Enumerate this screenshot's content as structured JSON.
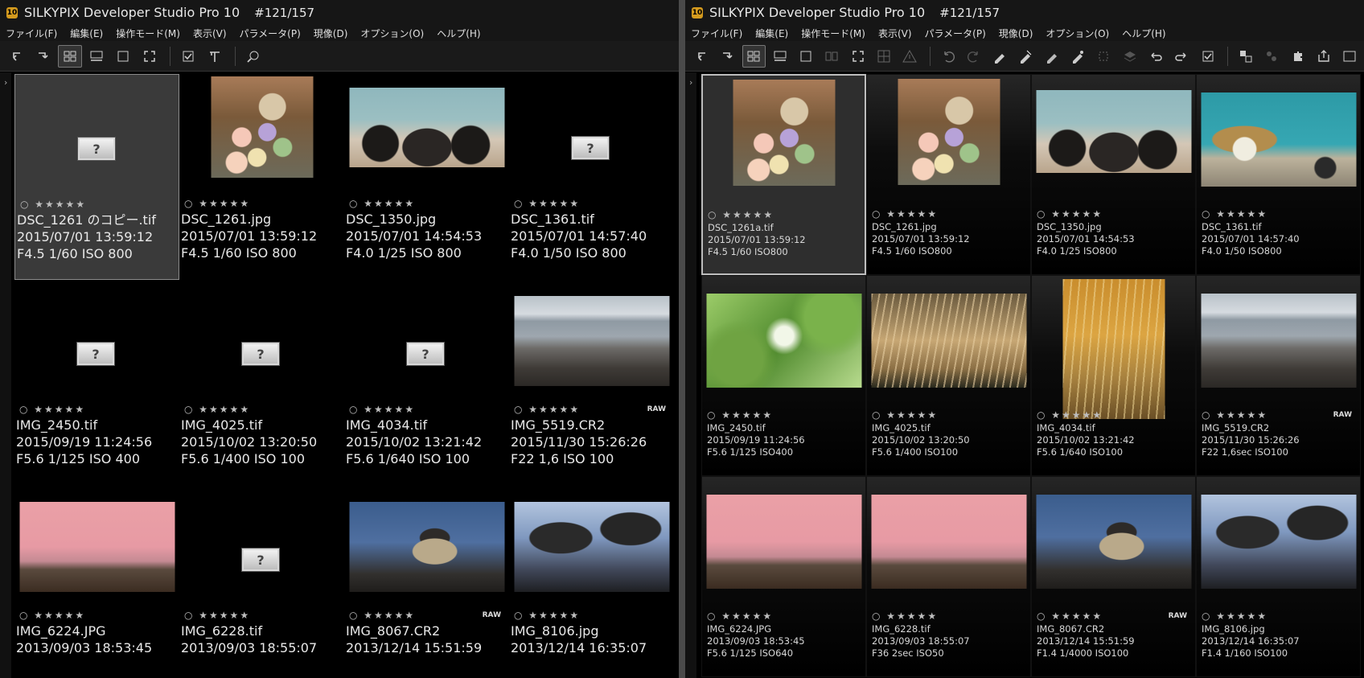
{
  "left": {
    "title": "SILKYPIX Developer Studio Pro 10",
    "counter": "#121/157",
    "logo": "10",
    "menu": [
      "ファイル(F)",
      "編集(E)",
      "操作モード(M)",
      "表示(V)",
      "パラメータ(P)",
      "現像(D)",
      "オプション(O)",
      "ヘルプ(H)"
    ],
    "collapse": "›",
    "items": [
      {
        "name": "DSC_1261 のコピー.tif",
        "date": "2015/07/01 13:59:12",
        "exif": "F4.5 1/60 ISO 800",
        "stars": "○ ★★★★★",
        "thumb": "none",
        "selected": true
      },
      {
        "name": "DSC_1261.jpg",
        "date": "2015/07/01 13:59:12",
        "exif": "F4.5 1/60 ISO 800",
        "stars": "○ ★★★★★",
        "thumb": "flowers"
      },
      {
        "name": "DSC_1350.jpg",
        "date": "2015/07/01 14:54:53",
        "exif": "F4.0 1/25 ISO 800",
        "stars": "○ ★★★★★",
        "thumb": "car"
      },
      {
        "name": "DSC_1361.tif",
        "date": "2015/07/01 14:57:40",
        "exif": "F4.0 1/50 ISO 800",
        "stars": "○ ★★★★★",
        "thumb": "none"
      },
      {
        "name": "IMG_2450.tif",
        "date": "2015/09/19 11:24:56",
        "exif": "F5.6 1/125 ISO 400",
        "stars": "○ ★★★★★",
        "thumb": "none"
      },
      {
        "name": "IMG_4025.tif",
        "date": "2015/10/02 13:20:50",
        "exif": "F5.6 1/400 ISO 100",
        "stars": "○ ★★★★★",
        "thumb": "none"
      },
      {
        "name": "IMG_4034.tif",
        "date": "2015/10/02 13:21:42",
        "exif": "F5.6 1/640 ISO 100",
        "stars": "○ ★★★★★",
        "thumb": "none"
      },
      {
        "name": "IMG_5519.CR2",
        "date": "2015/11/30 15:26:26",
        "exif": "F22 1,6 ISO 100",
        "stars": "○ ★★★★★",
        "thumb": "lake",
        "raw": "RAW"
      },
      {
        "name": "IMG_6224.JPG",
        "date": "2013/09/03 18:53:45",
        "exif": "",
        "stars": "○ ★★★★★",
        "thumb": "pink"
      },
      {
        "name": "IMG_6228.tif",
        "date": "2013/09/03 18:55:07",
        "exif": "",
        "stars": "○ ★★★★★",
        "thumb": "none"
      },
      {
        "name": "IMG_8067.CR2",
        "date": "2013/12/14 15:51:59",
        "exif": "",
        "stars": "○ ★★★★★",
        "thumb": "dome",
        "raw": "RAW"
      },
      {
        "name": "IMG_8106.jpg",
        "date": "2013/12/14 16:35:07",
        "exif": "",
        "stars": "○ ★★★★★",
        "thumb": "tree"
      }
    ]
  },
  "right": {
    "title": "SILKYPIX Developer Studio Pro 10",
    "counter": "#121/157",
    "logo": "10",
    "menu": [
      "ファイル(F)",
      "編集(E)",
      "操作モード(M)",
      "表示(V)",
      "パラメータ(P)",
      "現像(D)",
      "オプション(O)",
      "ヘルプ(H)"
    ],
    "collapse": "›",
    "items": [
      {
        "name": "DSC_1261a.tif",
        "date": "2015/07/01 13:59:12",
        "exif": "F4.5 1/60 ISO800",
        "stars": "○ ★★★★★",
        "thumb": "flowers",
        "selected": true
      },
      {
        "name": "DSC_1261.jpg",
        "date": "2015/07/01 13:59:12",
        "exif": "F4.5 1/60 ISO800",
        "stars": "○ ★★★★★",
        "thumb": "flowers"
      },
      {
        "name": "DSC_1350.jpg",
        "date": "2015/07/01 14:54:53",
        "exif": "F4.0 1/25 ISO800",
        "stars": "○ ★★★★★",
        "thumb": "car"
      },
      {
        "name": "DSC_1361.tif",
        "date": "2015/07/01 14:57:40",
        "exif": "F4.0 1/50 ISO800",
        "stars": "○ ★★★★★",
        "thumb": "owl"
      },
      {
        "name": "IMG_2450.tif",
        "date": "2015/09/19 11:24:56",
        "exif": "F5.6 1/125 ISO400",
        "stars": "○ ★★★★★",
        "thumb": "green"
      },
      {
        "name": "IMG_4025.tif",
        "date": "2015/10/02 13:20:50",
        "exif": "F5.6 1/400 ISO100",
        "stars": "○ ★★★★★",
        "thumb": "grass"
      },
      {
        "name": "IMG_4034.tif",
        "date": "2015/10/02 13:21:42",
        "exif": "F5.6 1/640 ISO100",
        "stars": "○ ★★★★★",
        "thumb": "grass2"
      },
      {
        "name": "IMG_5519.CR2",
        "date": "2015/11/30 15:26:26",
        "exif": "F22 1,6sec ISO100",
        "stars": "○ ★★★★★",
        "thumb": "lake",
        "raw": "RAW"
      },
      {
        "name": "IMG_6224.JPG",
        "date": "2013/09/03 18:53:45",
        "exif": "F5.6 1/125 ISO640",
        "stars": "○ ★★★★★",
        "thumb": "pink"
      },
      {
        "name": "IMG_6228.tif",
        "date": "2013/09/03 18:55:07",
        "exif": "F36 2sec ISO50",
        "stars": "○ ★★★★★",
        "thumb": "pink"
      },
      {
        "name": "IMG_8067.CR2",
        "date": "2013/12/14 15:51:59",
        "exif": "F1.4 1/4000 ISO100",
        "stars": "○ ★★★★★",
        "thumb": "dome",
        "raw": "RAW"
      },
      {
        "name": "IMG_8106.jpg",
        "date": "2013/12/14 16:35:07",
        "exif": "F1.4 1/160 ISO100",
        "stars": "○ ★★★★★",
        "thumb": "tree"
      }
    ]
  },
  "toolbar_left_icons": [
    "import-icon",
    "export-icon",
    "grid-view-icon",
    "filmstrip-view-icon",
    "single-view-icon",
    "fullscreen-icon",
    "check-icon",
    "hammer-icon",
    "zoom-search-icon"
  ],
  "toolbar_right_icons": [
    "import-icon",
    "export-icon",
    "grid-view-icon",
    "filmstrip-view-icon",
    "single-view-icon",
    "compare-view-icon",
    "fullscreen-icon",
    "dual-view-icon",
    "warning-icon",
    "undo-icon",
    "redo-icon",
    "develop-pen-icon",
    "develop-pen-2-icon",
    "develop-pen-3-icon",
    "develop-pen-4-icon",
    "crop-icon",
    "layers-icon",
    "rotate-left-icon",
    "rotate-right-icon",
    "check-icon",
    "batch-icon",
    "sync-icon",
    "plugin-icon",
    "share-icon",
    "preview-icon"
  ],
  "colors": {
    "logo": "#d49a1e",
    "background": "#000000",
    "selected_border": "#bdbdbd"
  }
}
